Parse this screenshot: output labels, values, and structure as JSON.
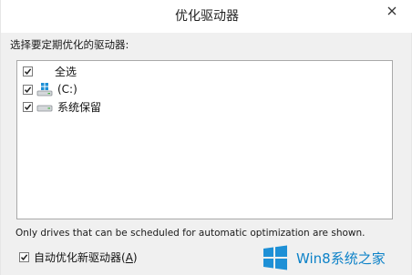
{
  "window": {
    "title": "优化驱动器"
  },
  "prompt": "选择要定期优化的驱动器:",
  "drive_list": {
    "items": [
      {
        "label": "全选",
        "checked": true,
        "icon": "none"
      },
      {
        "label": "(C:)",
        "checked": true,
        "icon": "windows-drive-icon"
      },
      {
        "label": "系统保留",
        "checked": true,
        "icon": "drive-icon"
      }
    ]
  },
  "note": "Only drives that can be scheduled for automatic optimization are shown.",
  "auto_optimize": {
    "label_prefix": "自动优化新驱动器(",
    "label_mnemonic": "A",
    "label_suffix": ")",
    "checked": true
  },
  "watermark": {
    "text": "Win8系统之家"
  },
  "colors": {
    "titlebar": "#ffffff",
    "dialog_bg": "#f0f0f0",
    "list_bg": "#ffffff",
    "watermark_blue": "#0d82c8",
    "windows_logo_blue": "#1e90d6"
  }
}
